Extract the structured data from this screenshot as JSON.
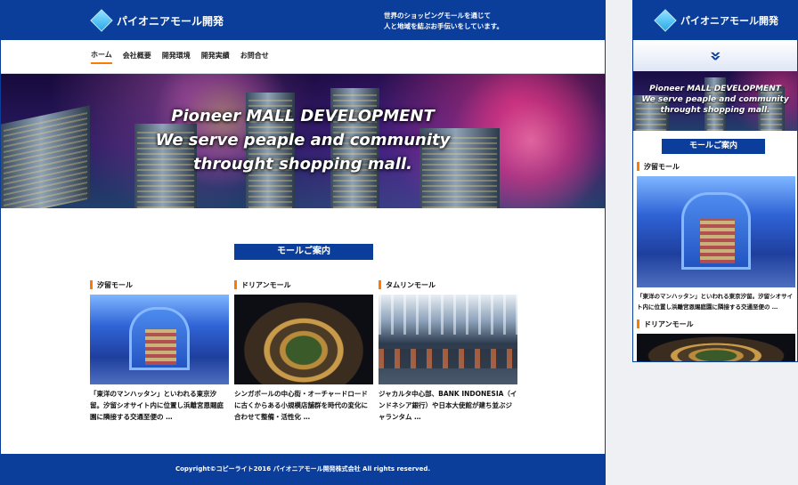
{
  "desktop": {
    "logo_text": "パイオニアモール開発",
    "tagline": [
      "世界のショッピングモールを通じて",
      "人と地域を結ぶお手伝いをしています。"
    ],
    "nav": [
      {
        "label": "ホーム",
        "active": true
      },
      {
        "label": "会社概要",
        "active": false
      },
      {
        "label": "開発環境",
        "active": false
      },
      {
        "label": "開発実績",
        "active": false
      },
      {
        "label": "お問合せ",
        "active": false
      }
    ],
    "hero_lines": [
      "Pioneer MALL DEVELOPMENT",
      "We serve peaple and community",
      "throught shopping mall."
    ],
    "section_title": "モールご案内",
    "cards": [
      {
        "title": "汐留モール",
        "text": "「東洋のマンハッタン」といわれる東京汐留。汐留シオサイト内に位置し浜離宮恩賜庭園に隣接する交通至便の …"
      },
      {
        "title": "ドリアンモール",
        "text": "シンガポールの中心街・オーチャードロードに古くからある小規模店舗群を時代の変化に合わせて整備・活性化 …"
      },
      {
        "title": "タムリンモール",
        "text": "ジャカルタ中心部、BANK INDONESIA（インドネシア銀行）や日本大使館が建ち並ぶジャランタム …"
      }
    ],
    "footer": "Copyright©コピーライト2016 パイオニアモール開発株式会社 All rights reserved."
  },
  "mobile": {
    "logo_text": "パイオニアモール開発",
    "arrow": "≫",
    "hero_lines": [
      "Pioneer MALL DEVELOPMENT",
      "We serve peaple and community",
      "throught shopping mall."
    ],
    "section_title": "モールご案内",
    "cards": [
      {
        "title": "汐留モール",
        "text": "「東洋のマンハッタン」といわれる東京汐留。汐留シオサイト内に位置し浜離宮恩賜庭園に隣接する交通至便の …"
      },
      {
        "title": "ドリアンモール",
        "text": ""
      }
    ]
  },
  "colors": {
    "brand": "#0b3e9a",
    "accent": "#ff7a00"
  }
}
